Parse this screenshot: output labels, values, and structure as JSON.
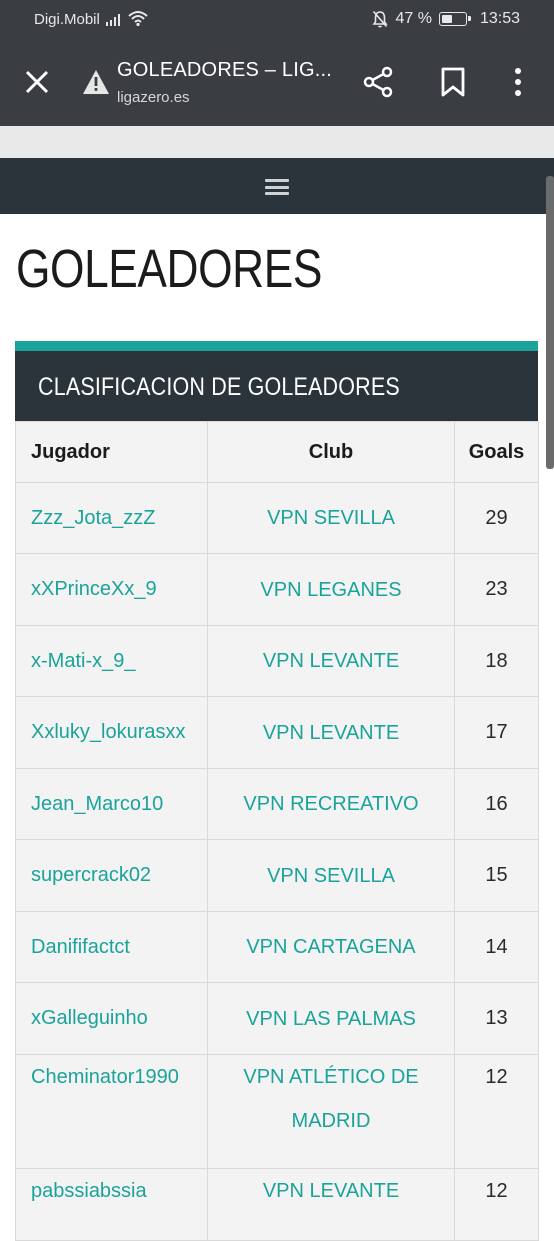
{
  "status_bar": {
    "carrier": "Digi.Mobil",
    "battery_text": "47 %",
    "time": "13:53",
    "icons": [
      "signal-icon",
      "wifi-icon",
      "bell-off-icon",
      "battery-icon"
    ]
  },
  "browser": {
    "tab_title": "GOLEADORES – LIG...",
    "url": "ligazero.es",
    "icons": [
      "close-icon",
      "warning-icon",
      "share-icon",
      "bookmark-icon",
      "more-icon"
    ]
  },
  "page": {
    "menu_icon": "hamburger-icon",
    "title": "GOLEADORES"
  },
  "widget": {
    "heading": "CLASIFICACION DE GOLEADORES",
    "accent_color": "#1aa39a",
    "header_color": "#2b333b"
  },
  "table": {
    "columns": [
      "Jugador",
      "Club",
      "Goals"
    ],
    "rows": [
      {
        "player": "Zzz_Jota_zzZ",
        "club": "VPN SEVILLA",
        "goals": "29"
      },
      {
        "player": "xXPrinceXx_9",
        "club": "VPN LEGANES",
        "goals": "23"
      },
      {
        "player": "x-Mati-x_9_",
        "club": "VPN LEVANTE",
        "goals": "18"
      },
      {
        "player": "Xxluky_lokurasxx",
        "club": "VPN LEVANTE",
        "goals": "17"
      },
      {
        "player": "Jean_Marco10",
        "club": "VPN RECREATIVO",
        "goals": "16"
      },
      {
        "player": "supercrack02",
        "club": "VPN SEVILLA",
        "goals": "15"
      },
      {
        "player": "Danififactct",
        "club": "VPN CARTAGENA",
        "goals": "14"
      },
      {
        "player": "xGalleguinho",
        "club": "VPN LAS PALMAS",
        "goals": "13"
      },
      {
        "player": "Cheminator1990",
        "club": "VPN ATLÉTICO DE MADRID",
        "goals": "12"
      },
      {
        "player": "pabssiabssia",
        "club": "VPN LEVANTE",
        "goals": "12"
      }
    ]
  }
}
